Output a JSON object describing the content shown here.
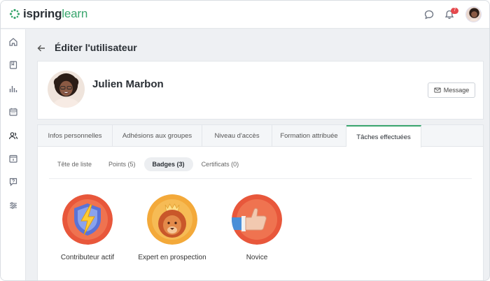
{
  "brand": {
    "name_part1": "ispring",
    "name_part2": "learn"
  },
  "header": {
    "notification_count": "7"
  },
  "page": {
    "title": "Éditer l'utilisateur"
  },
  "user": {
    "name": "Julien Marbon",
    "message_button": "Message"
  },
  "tabs": [
    {
      "label": "Infos personnelles"
    },
    {
      "label": "Adhésions aux groupes"
    },
    {
      "label": "Niveau d'accès"
    },
    {
      "label": "Formation attribuée"
    },
    {
      "label": "Tâches effectuées",
      "active": true
    }
  ],
  "subtabs": [
    {
      "label": "Tête de liste"
    },
    {
      "label": "Points (5)"
    },
    {
      "label": "Badges (3)",
      "active": true
    },
    {
      "label": "Certificats (0)"
    }
  ],
  "badges": [
    {
      "label": "Contributeur actif",
      "icon": "lightning-shield-icon"
    },
    {
      "label": "Expert en prospection",
      "icon": "lion-icon"
    },
    {
      "label": "Novice",
      "icon": "thumbs-up-icon"
    }
  ],
  "colors": {
    "accent": "#3aa66e",
    "badge_orange": "#e8573b",
    "badge_gold": "#f3a93a",
    "notification": "#e5484d"
  }
}
